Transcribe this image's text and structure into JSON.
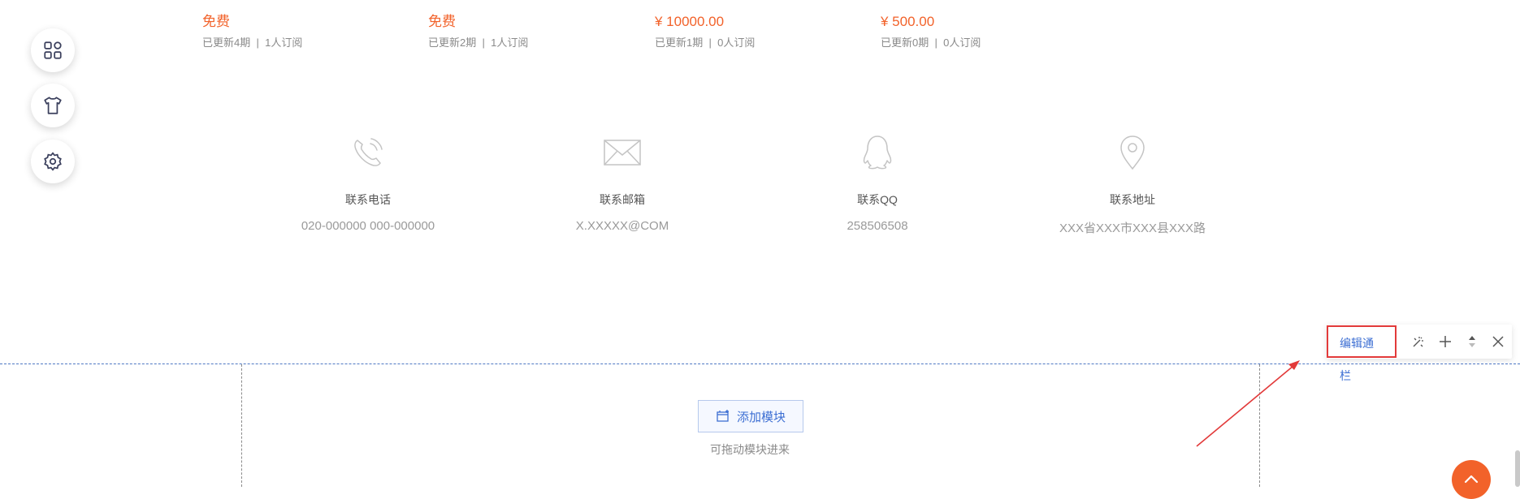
{
  "side_toolbar": {
    "items": [
      {
        "icon": "grid-icon"
      },
      {
        "icon": "tshirt-icon"
      },
      {
        "icon": "gear-icon"
      }
    ]
  },
  "subscriptions": [
    {
      "price": "免费",
      "updates": "已更新4期",
      "subscribers": "1人订阅"
    },
    {
      "price": "免费",
      "updates": "已更新2期",
      "subscribers": "1人订阅"
    },
    {
      "price": "¥ 10000.00",
      "updates": "已更新1期",
      "subscribers": "0人订阅"
    },
    {
      "price": "¥ 500.00",
      "updates": "已更新0期",
      "subscribers": "0人订阅"
    }
  ],
  "separator": "|",
  "contacts": [
    {
      "icon": "phone-icon",
      "label": "联系电话",
      "value": "020-000000 000-000000"
    },
    {
      "icon": "mail-icon",
      "label": "联系邮箱",
      "value": "X.XXXXX@COM"
    },
    {
      "icon": "qq-icon",
      "label": "联系QQ",
      "value": "258506508"
    },
    {
      "icon": "location-icon",
      "label": "联系地址",
      "value": "XXX省XXX市XXX县XXX路"
    }
  ],
  "column_toolbar": {
    "edit_label": "编辑通栏",
    "tools": [
      "magic-wand-icon",
      "plus-icon",
      "sort-icon",
      "close-icon"
    ]
  },
  "column": {
    "add_module_label": "添加模块",
    "drag_hint": "可拖动模块进来"
  },
  "colors": {
    "price": "#f2622a",
    "accent": "#3d6fd3",
    "highlight": "#e23a3a",
    "back_top": "#f2622a"
  }
}
